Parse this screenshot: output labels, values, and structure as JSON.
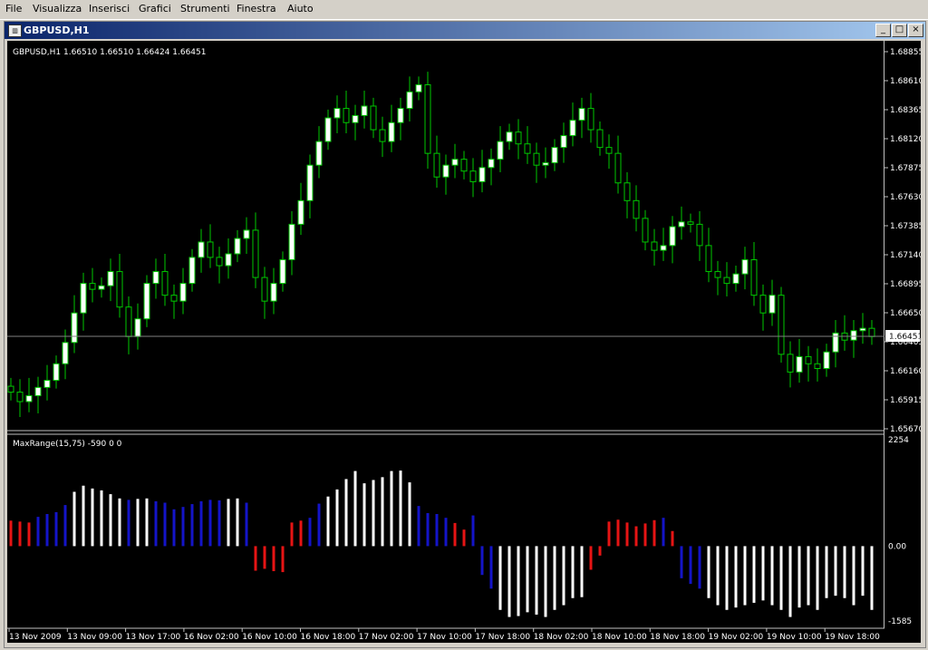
{
  "menu": {
    "items": [
      "File",
      "Visualizza",
      "Inserisci",
      "Grafici",
      "Strumenti",
      "Finestra",
      "Aiuto"
    ]
  },
  "window": {
    "title": "GBPUSD,H1",
    "icon": "chart-window-icon"
  },
  "price_panel": {
    "header": "GBPUSD,H1  1.66510 1.66510 1.66424 1.66451",
    "price_ticks": [
      "1.68855",
      "1.68610",
      "1.68365",
      "1.68120",
      "1.67875",
      "1.67630",
      "1.67385",
      "1.67140",
      "1.66895",
      "1.66650",
      "1.66405",
      "1.66160",
      "1.65915",
      "1.65670"
    ],
    "current_price": "1.66451",
    "colors": {
      "bull_body": "#ffffff",
      "bear_body": "#000000",
      "wick": "#00c800",
      "current_line": "#808080"
    }
  },
  "indicator_panel": {
    "header": "MaxRange(15,75) -590 0 0",
    "ticks": [
      "2254",
      "0.00",
      "-1585"
    ],
    "colors": {
      "white": "#ffffff",
      "blue": "#1414c8",
      "red": "#e61414"
    }
  },
  "time_axis": {
    "labels": [
      "13 Nov 2009",
      "13 Nov 09:00",
      "13 Nov 17:00",
      "16 Nov 02:00",
      "16 Nov 10:00",
      "16 Nov 18:00",
      "17 Nov 02:00",
      "17 Nov 10:00",
      "17 Nov 18:00",
      "18 Nov 02:00",
      "18 Nov 10:00",
      "18 Nov 18:00",
      "19 Nov 02:00",
      "19 Nov 10:00",
      "19 Nov 18:00"
    ]
  },
  "chart_data": [
    {
      "type": "candlestick",
      "title": "GBPUSD,H1",
      "ylim": [
        1.6567,
        1.6886
      ],
      "close_series": [
        1.6598,
        1.659,
        1.6595,
        1.6602,
        1.6608,
        1.6622,
        1.664,
        1.6665,
        1.669,
        1.6685,
        1.6688,
        1.67,
        1.667,
        1.6645,
        1.666,
        1.669,
        1.67,
        1.668,
        1.6675,
        1.669,
        1.6712,
        1.6725,
        1.6712,
        1.6705,
        1.6715,
        1.6728,
        1.6735,
        1.6695,
        1.6675,
        1.669,
        1.671,
        1.674,
        1.676,
        1.679,
        1.681,
        1.683,
        1.6838,
        1.6826,
        1.6832,
        1.684,
        1.682,
        1.681,
        1.6826,
        1.6838,
        1.6852,
        1.6858,
        1.68,
        1.678,
        1.679,
        1.6795,
        1.6785,
        1.6776,
        1.6788,
        1.6795,
        1.681,
        1.6818,
        1.6808,
        1.68,
        1.679,
        1.6792,
        1.6805,
        1.6815,
        1.6828,
        1.6838,
        1.682,
        1.6805,
        1.68,
        1.6775,
        1.676,
        1.6745,
        1.6725,
        1.6718,
        1.6722,
        1.6738,
        1.6742,
        1.674,
        1.6722,
        1.67,
        1.6695,
        1.669,
        1.6698,
        1.671,
        1.668,
        1.6665,
        1.668,
        1.663,
        1.6615,
        1.6628,
        1.6622,
        1.6618,
        1.6632,
        1.6648,
        1.6642,
        1.665,
        1.6652,
        1.6645
      ]
    },
    {
      "type": "bar",
      "title": "MaxRange(15,75) -590 0 0",
      "ylim": [
        -1585,
        2254
      ],
      "values": [
        540,
        520,
        500,
        620,
        680,
        720,
        870,
        1150,
        1280,
        1220,
        1180,
        1100,
        1010,
        980,
        1000,
        1010,
        950,
        920,
        780,
        830,
        890,
        950,
        980,
        970,
        1000,
        1010,
        920,
        -520,
        -480,
        -530,
        -550,
        500,
        540,
        600,
        900,
        1050,
        1200,
        1420,
        1590,
        1330,
        1400,
        1460,
        1590,
        1600,
        1350,
        850,
        700,
        680,
        600,
        490,
        350,
        650,
        -610,
        -900,
        -1350,
        -1500,
        -1480,
        -1400,
        -1450,
        -1500,
        -1350,
        -1250,
        -1100,
        -1080,
        -500,
        -200,
        520,
        560,
        500,
        420,
        480,
        550,
        600,
        320,
        -680,
        -800,
        -900,
        -1100,
        -1250,
        -1350,
        -1300,
        -1250,
        -1200,
        -1150,
        -1250,
        -1350,
        -1500,
        -1300,
        -1250,
        -1350,
        -1100,
        -1050,
        -1100,
        -1250,
        -1050,
        -1350
      ]
    }
  ]
}
